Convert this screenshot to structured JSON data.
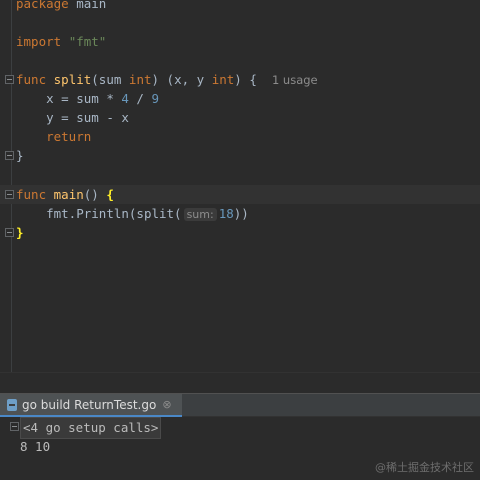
{
  "editor": {
    "lines": {
      "package": {
        "kw": "package",
        "name": "main"
      },
      "import": {
        "kw": "import",
        "path": "\"fmt\""
      },
      "split_sig": {
        "kw": "func",
        "name": "split",
        "params_open": "(sum ",
        "param_type": "int",
        "params_close": ") (x, y ",
        "ret_type": "int",
        "tail": ") {",
        "usage_hint": "1 usage"
      },
      "x_assign": {
        "left": "x = sum * ",
        "n1": "4",
        "op": " / ",
        "n2": "9"
      },
      "y_assign": {
        "text": "y = sum - x"
      },
      "return": {
        "kw": "return"
      },
      "close1": {
        "text": "}"
      },
      "main_sig": {
        "kw": "func",
        "name": "main",
        "parens": "() ",
        "brace": "{"
      },
      "println": {
        "pre": "fmt.Println(split(",
        "inlay": "sum:",
        "arg": "18",
        "post": "))"
      },
      "close2": {
        "text": "}"
      }
    }
  },
  "run_panel": {
    "tab_label": "go build ReturnTest.go",
    "tab_close": "⊗",
    "setup_calls": "<4 go setup calls>",
    "output": "8 10"
  },
  "watermark": "@稀土掘金技术社区",
  "colors": {
    "keyword": "#cc7832",
    "function": "#ffc66d",
    "number": "#6897bb",
    "string": "#6a8759",
    "brace_match": "#ffef28"
  }
}
